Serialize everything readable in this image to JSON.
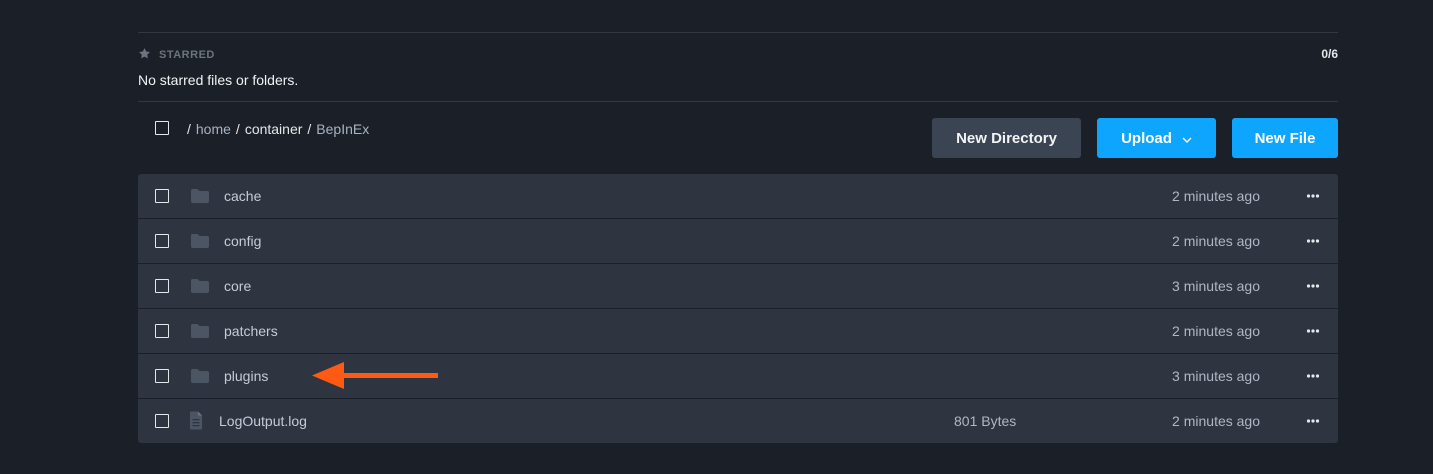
{
  "starred": {
    "heading": "STARRED",
    "count": "0/6",
    "empty_message": "No starred files or folders."
  },
  "breadcrumb": {
    "root_sep": "/",
    "home": "home",
    "sep1": "/",
    "container": "container",
    "sep2": "/",
    "current": "BepInEx"
  },
  "toolbar": {
    "new_directory_label": "New Directory",
    "upload_label": "Upload",
    "new_file_label": "New File"
  },
  "files": [
    {
      "name": "cache",
      "type": "folder",
      "size": "",
      "modified": "2 minutes ago"
    },
    {
      "name": "config",
      "type": "folder",
      "size": "",
      "modified": "2 minutes ago"
    },
    {
      "name": "core",
      "type": "folder",
      "size": "",
      "modified": "3 minutes ago"
    },
    {
      "name": "patchers",
      "type": "folder",
      "size": "",
      "modified": "2 minutes ago"
    },
    {
      "name": "plugins",
      "type": "folder",
      "size": "",
      "modified": "3 minutes ago"
    },
    {
      "name": "LogOutput.log",
      "type": "file",
      "size": "801 Bytes",
      "modified": "2 minutes ago"
    }
  ],
  "colors": {
    "background": "#1b1f27",
    "row": "#2e3540",
    "accent": "#0ea5ff",
    "annotation_arrow": "#ff5a14"
  },
  "icons": {
    "starred": "star-icon",
    "folder": "folder-icon",
    "file": "file-text-icon",
    "more": "more-horizontal-icon",
    "upload_caret": "chevron-down-icon"
  }
}
